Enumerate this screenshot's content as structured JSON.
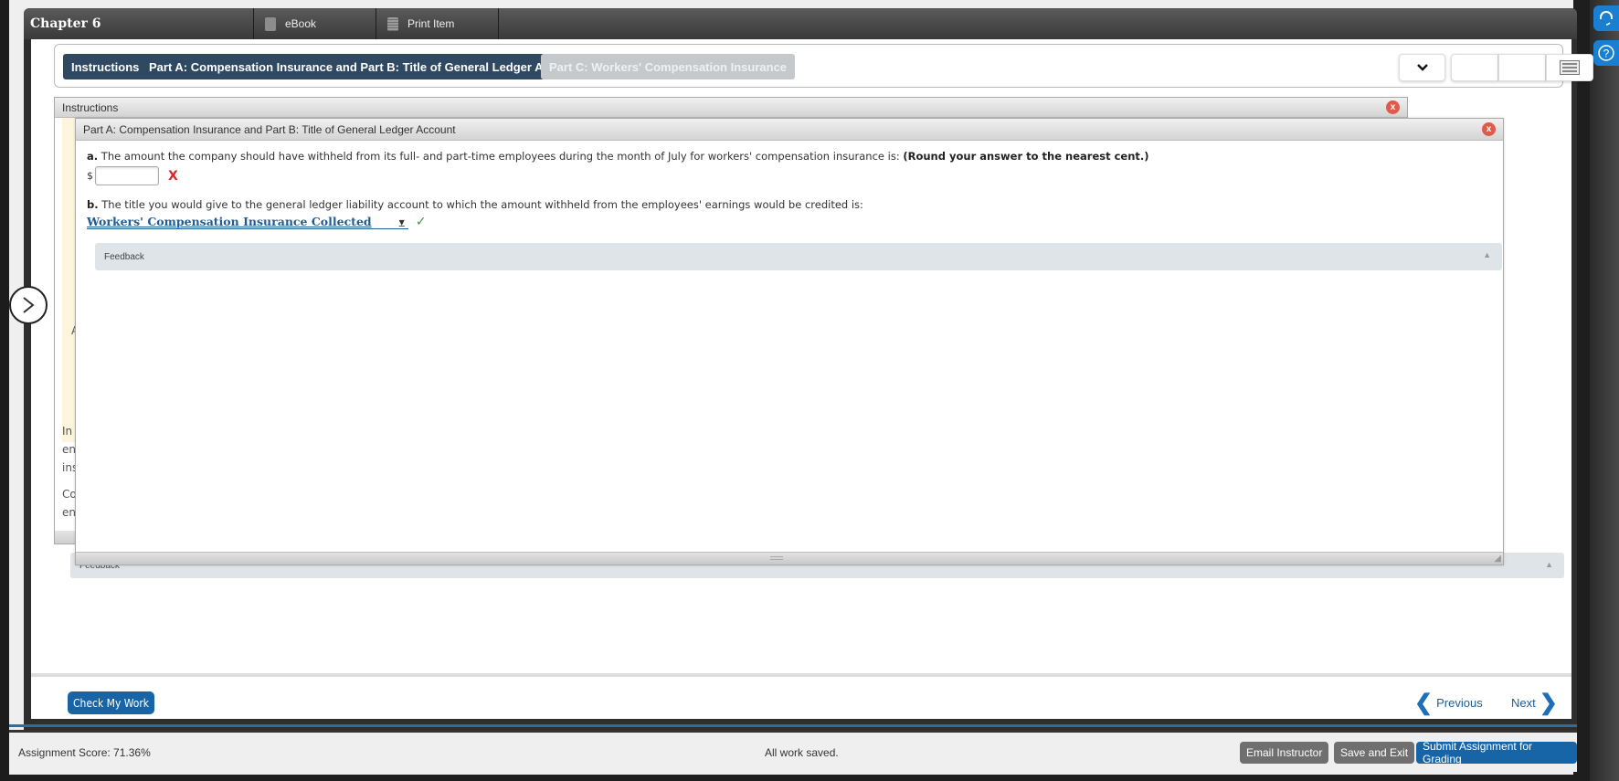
{
  "header": {
    "title": "Chapter 6",
    "ebook_label": "eBook",
    "print_label": "Print Item"
  },
  "tabs": [
    {
      "label": "Instructions",
      "state": "active"
    },
    {
      "label": "Part A: Compensation Insurance and Part B: Title of General Ledger Account",
      "state": "active"
    },
    {
      "label": "Part C: Workers' Compensation Insurance",
      "state": "disabled"
    }
  ],
  "instructions_panel": {
    "title": "Instructions",
    "peek_lines": [
      "A",
      "In",
      "en",
      "ins",
      "Co",
      "en"
    ]
  },
  "part_a_panel": {
    "title": "Part A: Compensation Insurance and Part B: Title of General Ledger Account",
    "question_a": {
      "letter": "a.",
      "text": "The amount the company should have withheld from its full- and part-time employees during the month of July for workers' compensation insurance is:",
      "instruction": "(Round your answer to the nearest cent.)",
      "currency": "$",
      "value": "",
      "status": "incorrect",
      "status_mark": "X"
    },
    "question_b": {
      "letter": "b.",
      "text": "The title you would give to the general ledger liability account to which the amount withheld from the employees' earnings would be credited is:",
      "selected": "Workers' Compensation Insurance Collected",
      "status": "correct",
      "status_mark": "✓"
    },
    "feedback_label": "Feedback"
  },
  "outer_feedback_label": "Feedback",
  "footer": {
    "check_label": "Check My Work",
    "previous_label": "Previous",
    "next_label": "Next"
  },
  "status_bar": {
    "score": "Assignment Score: 71.36%",
    "saved": "All work saved.",
    "email_label": "Email Instructor",
    "save_exit_label": "Save and Exit",
    "submit_label": "Submit Assignment for Grading"
  },
  "colors": {
    "tab_active": "#2f4962",
    "tab_disabled": "#c6c9cc",
    "primary_button": "#1765a6",
    "gray_button": "#6f6f6f",
    "incorrect": "#d8262a",
    "correct": "#3a9a3a"
  }
}
